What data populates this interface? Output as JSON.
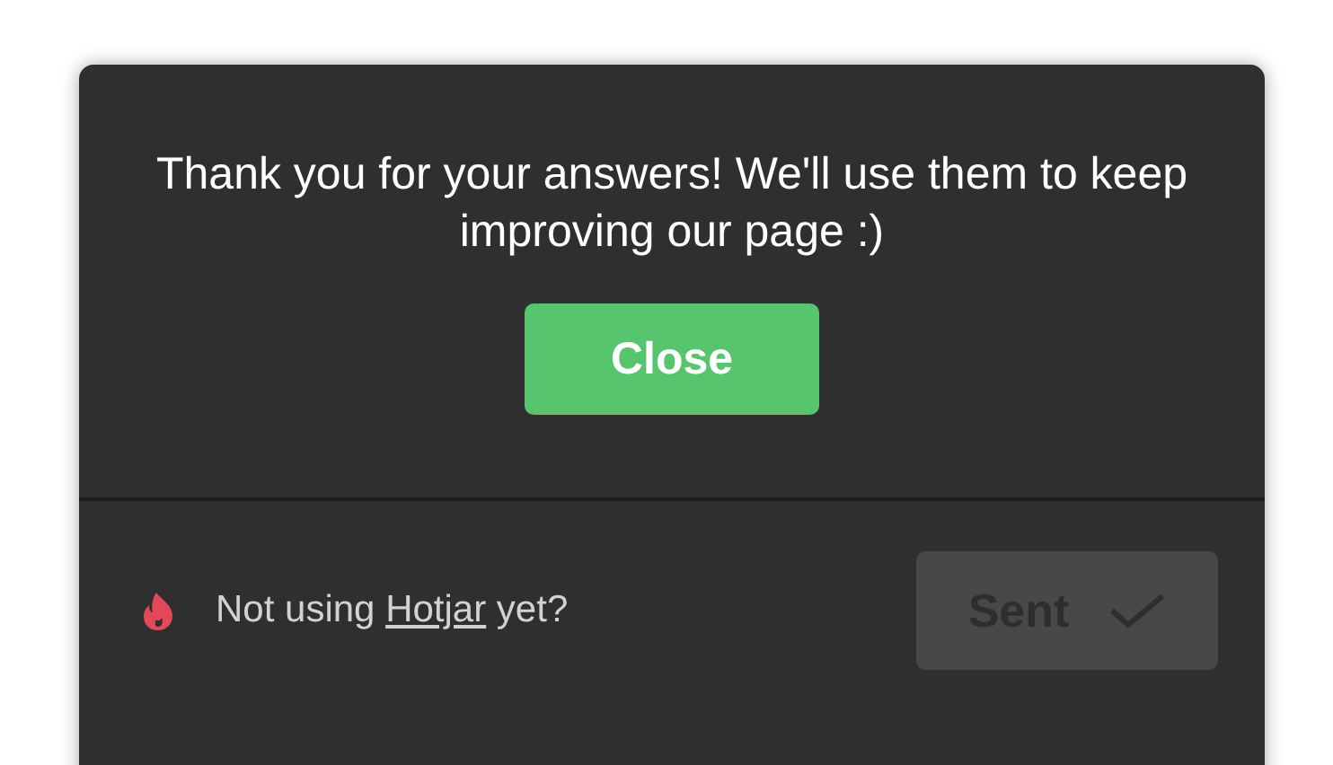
{
  "message": "Thank you for your answers! We'll use them to keep improving our page :)",
  "close_button": {
    "label": "Close"
  },
  "footer": {
    "text_before": "Not using ",
    "link": "Hotjar",
    "text_after": " yet?"
  },
  "sent_button": {
    "label": "Sent",
    "disabled": true
  }
}
